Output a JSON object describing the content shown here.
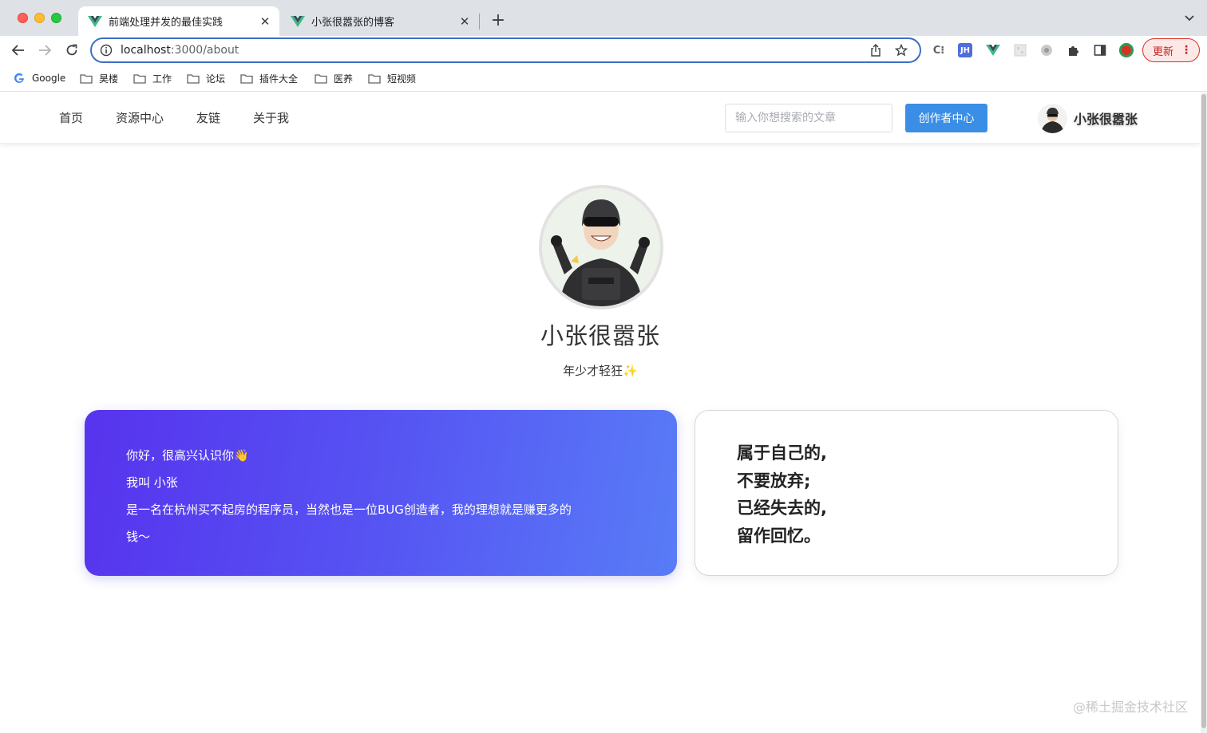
{
  "browser": {
    "tabs": [
      {
        "title": "前端处理并发的最佳实践",
        "active": true,
        "favicon": "vue-icon"
      },
      {
        "title": "小张很嚣张的博客",
        "active": false,
        "favicon": "vue-icon"
      }
    ],
    "close_glyph": "✕",
    "newtab_glyph": "+",
    "url_host": "localhost",
    "url_rest": ":3000/about",
    "update_label": "更新",
    "update_dots": "⋮",
    "extensions": [
      "C⁝",
      "JH"
    ],
    "accent": "#3c6fc4"
  },
  "bookmarks": [
    {
      "label": "Google",
      "icon": "google-icon"
    },
    {
      "label": "昊楼",
      "icon": "folder-icon"
    },
    {
      "label": "工作",
      "icon": "folder-icon"
    },
    {
      "label": "论坛",
      "icon": "folder-icon"
    },
    {
      "label": "插件大全",
      "icon": "folder-icon"
    },
    {
      "label": "医养",
      "icon": "folder-icon"
    },
    {
      "label": "短视频",
      "icon": "folder-icon"
    }
  ],
  "site": {
    "nav": [
      "首页",
      "资源中心",
      "友链",
      "关于我"
    ],
    "search_placeholder": "输入你想搜索的文章",
    "creator_button": "创作者中心",
    "username": "小张很嚣张",
    "button_color": "#409eff"
  },
  "profile": {
    "name": "小张很嚣张",
    "motto": "年少才轻狂",
    "motto_emoji": "✨"
  },
  "intro_card": {
    "lines": [
      "你好，很高兴认识你👋",
      "我叫 小张",
      "是一名在杭州买不起房的程序员，当然也是一位BUG创造者，我的理想就是赚更多的",
      "钱～"
    ],
    "gradient_start": "#5733ee",
    "gradient_end": "#587cf7"
  },
  "quote_card": {
    "lines": [
      "属于自己的,",
      "不要放弃;",
      "已经失去的,",
      "留作回忆。"
    ]
  },
  "watermark": "@稀土掘金技术社区"
}
